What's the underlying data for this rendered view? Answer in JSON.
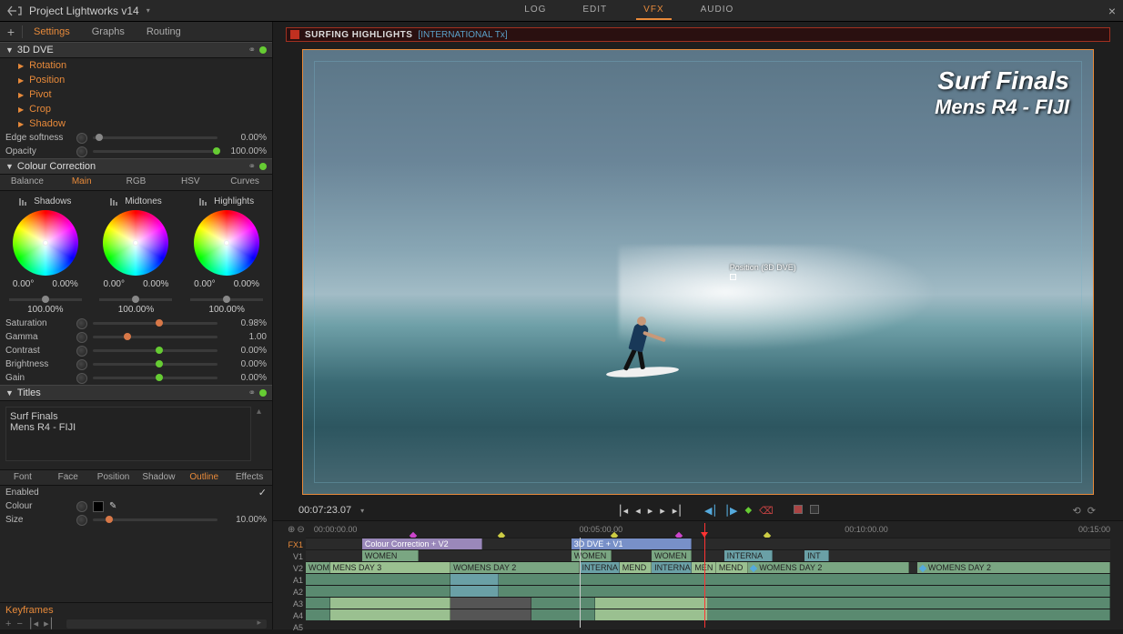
{
  "header": {
    "project_title": "Project Lightworks v14",
    "tabs": {
      "log": "LOG",
      "edit": "EDIT",
      "vfx": "VFX",
      "audio": "AUDIO"
    }
  },
  "left_panel": {
    "tabs": {
      "settings": "Settings",
      "graphs": "Graphs",
      "routing": "Routing"
    },
    "dve": {
      "title": "3D DVE",
      "items": {
        "rotation": "Rotation",
        "position": "Position",
        "pivot": "Pivot",
        "crop": "Crop",
        "shadow": "Shadow"
      },
      "edge_softness": {
        "label": "Edge softness",
        "value": "0.00%"
      },
      "opacity": {
        "label": "Opacity",
        "value": "100.00%"
      }
    },
    "cc": {
      "title": "Colour Correction",
      "tabs": {
        "balance": "Balance",
        "main": "Main",
        "rgb": "RGB",
        "hsv": "HSV",
        "curves": "Curves"
      },
      "wheels": {
        "shadows": {
          "label": "Shadows",
          "v1": "0.00°",
          "v2": "0.00%",
          "v3": "100.00%"
        },
        "midtones": {
          "label": "Midtones",
          "v1": "0.00°",
          "v2": "0.00%",
          "v3": "100.00%"
        },
        "highlights": {
          "label": "Highlights",
          "v1": "0.00°",
          "v2": "0.00%",
          "v3": "100.00%"
        }
      },
      "saturation": {
        "label": "Saturation",
        "value": "0.98%"
      },
      "gamma": {
        "label": "Gamma",
        "value": "1.00"
      },
      "contrast": {
        "label": "Contrast",
        "value": "0.00%"
      },
      "brightness": {
        "label": "Brightness",
        "value": "0.00%"
      },
      "gain": {
        "label": "Gain",
        "value": "0.00%"
      }
    },
    "titles": {
      "title": "Titles",
      "text": "Surf Finals\nMens R4 - FIJI",
      "tabs": {
        "font": "Font",
        "face": "Face",
        "position": "Position",
        "shadow": "Shadow",
        "outline": "Outline",
        "effects": "Effects"
      },
      "enabled": {
        "label": "Enabled"
      },
      "colour": {
        "label": "Colour"
      },
      "size": {
        "label": "Size",
        "value": "10.00%"
      }
    },
    "keyframes": {
      "label": "Keyframes"
    }
  },
  "viewer": {
    "clip_name": "SURFING HIGHLIGHTS",
    "clip_sub": "[INTERNATIONAL Tx]",
    "pos_marker": "Position (3D DVE)",
    "title_l1": "Surf Finals",
    "title_l2": "Mens R4 - FIJI",
    "timecode": "00:07:23.07"
  },
  "timeline": {
    "ticks": {
      "t0": "00:00:00.00",
      "t5": "00:05:00.00",
      "t10": "00:10:00.00",
      "t15": "00:15:00"
    },
    "tracks": {
      "fx1": "FX1",
      "v1": "V1",
      "v2": "V2",
      "a1": "A1",
      "a2": "A2",
      "a3": "A3",
      "a4": "A4",
      "a5": "A5"
    },
    "fx_clips": {
      "cc": "Colour Correction + V2",
      "dve": "3D DVE + V1"
    },
    "v1_clips": {
      "a": "WOMEN",
      "b": "WOMEN",
      "c": "WOMEN",
      "d": "INTERNA",
      "e": "INT"
    },
    "v2_clips": {
      "a": "WOM",
      "b": "MENS DAY 3",
      "c": "WOMENS DAY 2",
      "d": "INTERNA",
      "e": "MEND",
      "f": "INTERNA",
      "g": "MEN",
      "h": "MEND",
      "i": "WOMENS DAY 2",
      "j": "WOMENS DAY 2"
    }
  }
}
